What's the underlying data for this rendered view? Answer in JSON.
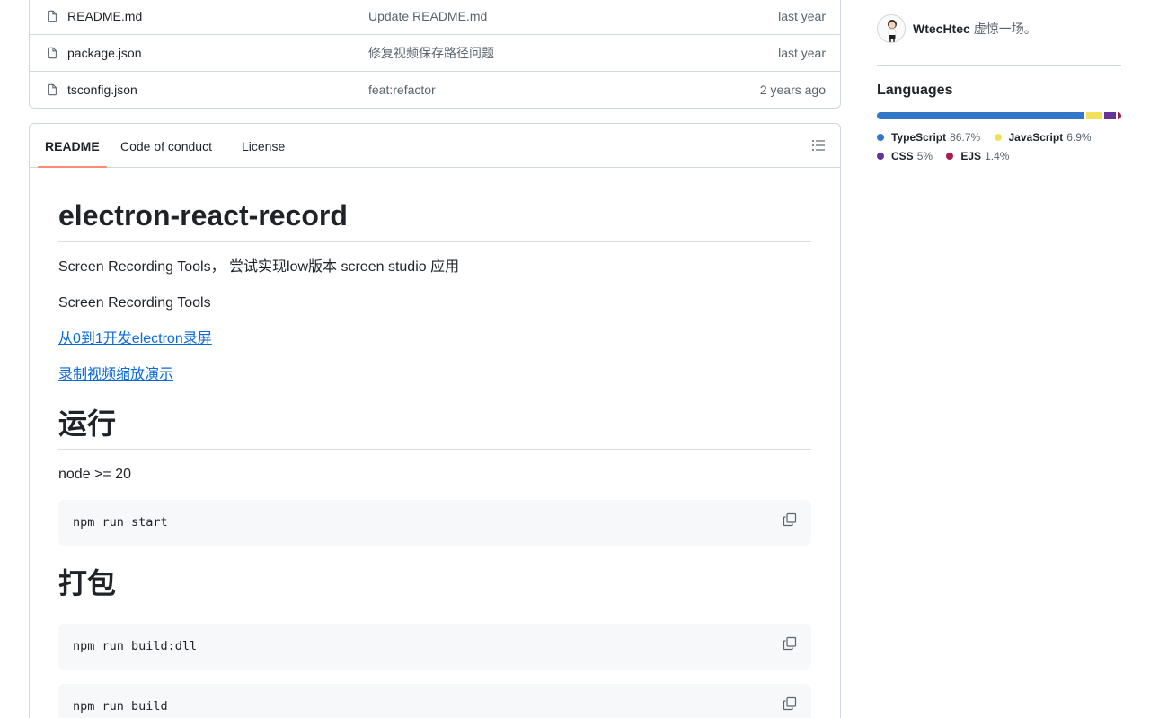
{
  "files": [
    {
      "name": "README.md",
      "commit": "Update README.md",
      "age": "last year"
    },
    {
      "name": "package.json",
      "commit": "修复视频保存路径问题",
      "age": "last year"
    },
    {
      "name": "tsconfig.json",
      "commit": "feat:refactor",
      "age": "2 years ago"
    }
  ],
  "readme": {
    "tabs": {
      "readme": "README",
      "conduct": "Code of conduct",
      "license": "License"
    },
    "title": "electron-react-record",
    "p1": "Screen Recording Tools， 尝试实现low版本 screen studio 应用",
    "p2": "Screen Recording Tools",
    "link1": "从0到1开发electron录屏",
    "link2": "录制视频缩放演示",
    "h_run": "运行",
    "node_req": "node >= 20",
    "code_start": "npm run start",
    "h_pack": "打包",
    "code_dll": "npm run build:dll",
    "code_build": "npm run build"
  },
  "sidebar": {
    "contributor": {
      "name": "WtecHtec",
      "note": "虚惊一场。"
    },
    "languages_title": "Languages",
    "languages": [
      {
        "name": "TypeScript",
        "pct": "86.7%",
        "value": 86.7,
        "color": "#3178c6"
      },
      {
        "name": "JavaScript",
        "pct": "6.9%",
        "value": 6.9,
        "color": "#f1e05a"
      },
      {
        "name": "CSS",
        "pct": "5%",
        "value": 5.0,
        "color": "#663399"
      },
      {
        "name": "EJS",
        "pct": "1.4%",
        "value": 1.4,
        "color": "#a91e50"
      }
    ]
  }
}
